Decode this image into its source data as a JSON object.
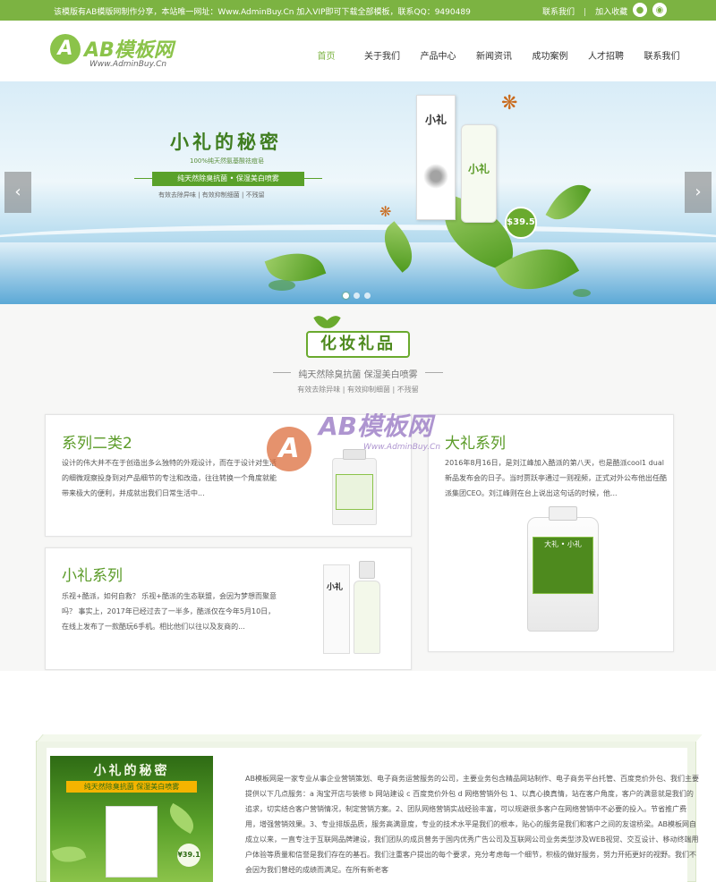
{
  "topbar": {
    "notice": "该模版有AB模版网制作分享，本站唯一网址：Www.AdminBuy.Cn 加入VIP即可下载全部模板，联系QQ：9490489",
    "links": [
      "联系我们",
      "加入收藏"
    ]
  },
  "header": {
    "logo_mark": "A",
    "logo_name": "AB模板网",
    "logo_url": "Www.AdminBuy.Cn",
    "nav": [
      "首页",
      "关于我们",
      "产品中心",
      "新闻资讯",
      "成功案例",
      "人才招聘",
      "联系我们"
    ]
  },
  "banner": {
    "title": "小礼的秘密",
    "subtitle": "100%纯天然氨基酸祛痘皂",
    "ribbon": "纯天然除臭抗菌 • 保湿美白喷雾",
    "features": "有效去除异味 | 有效抑制细菌 | 不残留",
    "bottle_label_1": "小礼",
    "bottle_label_2": "小礼",
    "price": "$39.5",
    "arrow_left": "‹",
    "arrow_right": "›"
  },
  "section": {
    "title": "化妆礼品",
    "subtitle": "纯天然除臭抗菌 保湿美白喷雾",
    "features": "有效去除异味 | 有效抑制细菌 | 不残留"
  },
  "cards": [
    {
      "title": "系列二类2",
      "text": "设计的伟大并不在于创造出多么独特的外观设计，而在于设计对生活的细微观察投身到对产品细节的专注和改造，往往转换一个角度就能带来极大的便利，并成就出我们日常生活中..."
    },
    {
      "title": "大礼系列",
      "text": "2016年8月16日，是刘江峰加入酷派的第八天，也是酷派cool1 dual新品发布会的日子。当时贾跃亭通过一则视频，正式对外公布他出任酷派集团CEO。刘江峰则在台上说出这句话的时候，他...",
      "bottle_label": "大礼 • 小礼"
    },
    {
      "title": "小礼系列",
      "text": "乐视+酷派，如何自救？ 乐视+酷派的生态联盟，会因为梦想而聚意吗？ 事实上，2017年已经过去了一半多，酷派仅在今年5月10日，在线上发布了一款酷玩6手机。相比他们以往以及友商的...",
      "bottle_label": "小礼"
    }
  ],
  "watermark": {
    "mark": "A",
    "name": "AB模板网",
    "url": "Www.AdminBuy.Cn"
  },
  "about": {
    "image_title": "小礼的秘密",
    "image_ribbon": "纯天然除臭抗菌 保湿美白喷雾",
    "image_price": "¥39.1",
    "text": "AB模板网是一家专业从事企业营销策划、电子商务运营服务的公司，主要业务包含精品网站制作、电子商务平台托管、百度竞价外包、我们主要提供以下几点服务：a 淘宝开店与装修 b 网站建设 c 百度竞价外包 d 网络营销外包 1、以真心换真情，站在客户角度，客户的满意就是我们的追求，切实结合客户营销情况，制定营销方案。2、团队网络营销实战经验丰富，可以规避很多客户在网络营销中不必要的投入。节省推广费用，增强营销效果。3、专业排版品质，服务高满意度，专业的技术水平是我们的根本，贴心的服务是我们和客户之间的友谊桥梁。AB模板网自成立以来，一直专注于互联网品牌建设，我们团队的成员曾务于国内优秀广告公司及互联网公司业务类型涉及WEB视觉、交互设计、移动终端用户体验等质量和信誉是我们存在的基石。我们注重客户提出的每个要求，充分考虑每一个细节，积极的做好服务，努力开拓更好的视野。我们不会因为我们曾经的成绩而满足。在所有新老客"
  },
  "colors": {
    "brand": "#7cb342",
    "title_green": "#5b9b28"
  }
}
